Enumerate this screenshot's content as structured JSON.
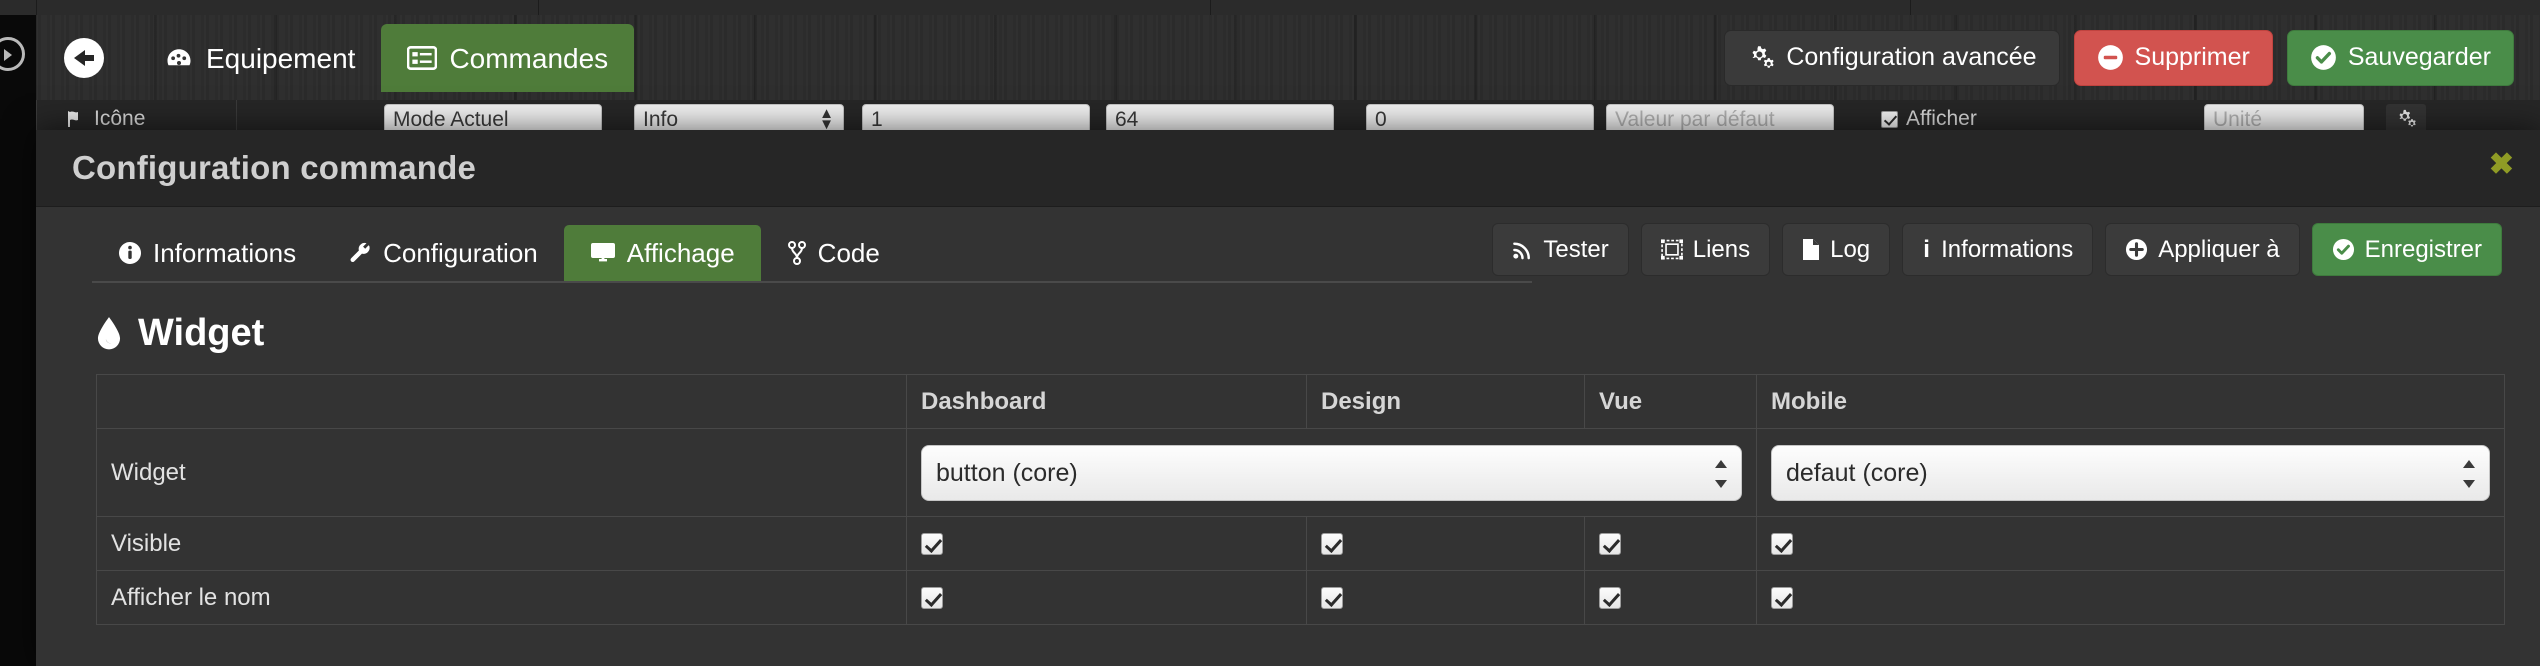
{
  "navbar": {
    "back_label": "",
    "tabs": [
      {
        "label": "Equipement",
        "icon": "tachometer-icon",
        "active": false
      },
      {
        "label": "Commandes",
        "icon": "list-alt-icon",
        "active": true
      }
    ],
    "buttons": [
      {
        "label": "Configuration avancée",
        "icon": "cogs-icon",
        "style": "dark"
      },
      {
        "label": "Supprimer",
        "icon": "minus-circle-icon",
        "style": "red"
      },
      {
        "label": "Sauvegarder",
        "icon": "check-circle-icon",
        "style": "green"
      }
    ]
  },
  "background_row": {
    "icon_label": "Icône",
    "name_value": "Mode Actuel",
    "type_value": "Info",
    "num1_value": "1",
    "num2_value": "64",
    "num3_value": "0",
    "ghost_value": "Valeur par défaut",
    "afficher_label": "Afficher",
    "unite_placeholder": "Unité",
    "gear_icon": "cogs-icon"
  },
  "modal": {
    "title": "Configuration commande",
    "close_label": "✖",
    "tabs": [
      {
        "label": "Informations",
        "icon": "info-circle-icon",
        "active": false
      },
      {
        "label": "Configuration",
        "icon": "wrench-icon",
        "active": false
      },
      {
        "label": "Affichage",
        "icon": "desktop-icon",
        "active": true
      },
      {
        "label": "Code",
        "icon": "code-branch-icon",
        "active": false
      }
    ],
    "toolbar": [
      {
        "label": "Tester",
        "icon": "rss-icon",
        "style": "dark"
      },
      {
        "label": "Liens",
        "icon": "object-group-icon",
        "style": "dark"
      },
      {
        "label": "Log",
        "icon": "file-icon",
        "style": "dark"
      },
      {
        "label": "Informations",
        "icon": "info-icon",
        "style": "dark"
      },
      {
        "label": "Appliquer à",
        "icon": "plus-circle-icon",
        "style": "dark"
      },
      {
        "label": "Enregistrer",
        "icon": "check-circle-icon",
        "style": "green"
      }
    ],
    "section": {
      "title": "Widget",
      "icon": "tint-icon"
    },
    "table": {
      "headers": [
        "",
        "Dashboard",
        "Design",
        "Vue",
        "Mobile"
      ],
      "rows": [
        {
          "label": "Widget",
          "type": "select",
          "dashboard_value": "button (core)",
          "mobile_value": "defaut (core)"
        },
        {
          "label": "Visible",
          "type": "checkbox",
          "dashboard": true,
          "design": true,
          "vue": true,
          "mobile": true
        },
        {
          "label": "Afficher le nom",
          "type": "checkbox",
          "dashboard": true,
          "design": true,
          "vue": true,
          "mobile": true
        }
      ]
    }
  },
  "colors": {
    "accent_green": "#4f7c3a",
    "button_green": "#4a8d49",
    "danger_red": "#d2534f",
    "modal_bg": "#333333",
    "modal_head_bg": "#262626",
    "close_green": "#8f9b25"
  }
}
